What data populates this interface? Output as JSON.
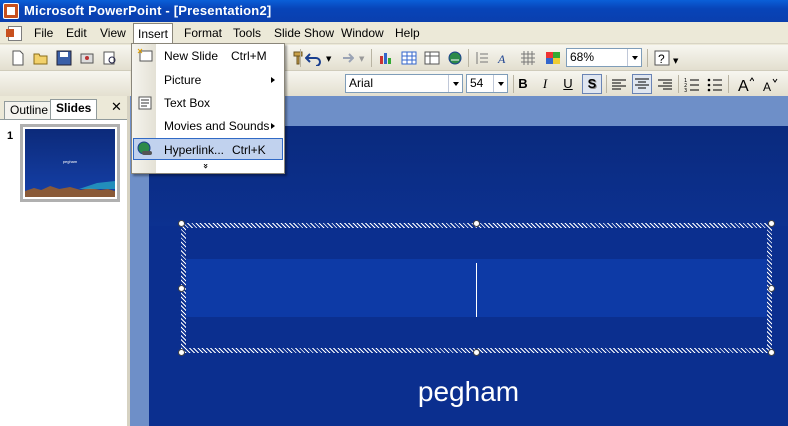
{
  "window": {
    "title": "Microsoft PowerPoint - [Presentation2]"
  },
  "menubar": {
    "items": [
      "File",
      "Edit",
      "View",
      "Insert",
      "Format",
      "Tools",
      "Slide Show",
      "Window",
      "Help"
    ],
    "open_item": "Insert"
  },
  "insert_menu": {
    "items": [
      {
        "label": "New Slide",
        "shortcut": "Ctrl+M",
        "icon": "new-slide-icon"
      },
      {
        "label": "Picture",
        "shortcut": "",
        "submenu": true
      },
      {
        "label": "Text Box",
        "shortcut": "",
        "icon": "text-box-icon"
      },
      {
        "label": "Movies and Sounds",
        "shortcut": "",
        "submenu": true
      },
      {
        "label": "Hyperlink...",
        "shortcut": "Ctrl+K",
        "icon": "hyperlink-icon",
        "highlighted": true
      }
    ],
    "expand_glyph": "»"
  },
  "standard_toolbar": {
    "zoom": "68%"
  },
  "formatting_toolbar": {
    "font": "Arial",
    "font_size": "54",
    "bold": "B",
    "italic": "I",
    "underline": "U",
    "shadow": "S"
  },
  "left_pane": {
    "tabs": [
      "Outline",
      "Slides"
    ],
    "active_tab": "Slides",
    "close": "✕",
    "slides": [
      {
        "number": "1",
        "text": "pegham"
      }
    ]
  },
  "slide": {
    "subtitle": "pegham"
  },
  "colors": {
    "title_bar": "#0a4fc8",
    "slide_background": "#0b2f8f",
    "menu_highlight": "#c1d2ee"
  }
}
